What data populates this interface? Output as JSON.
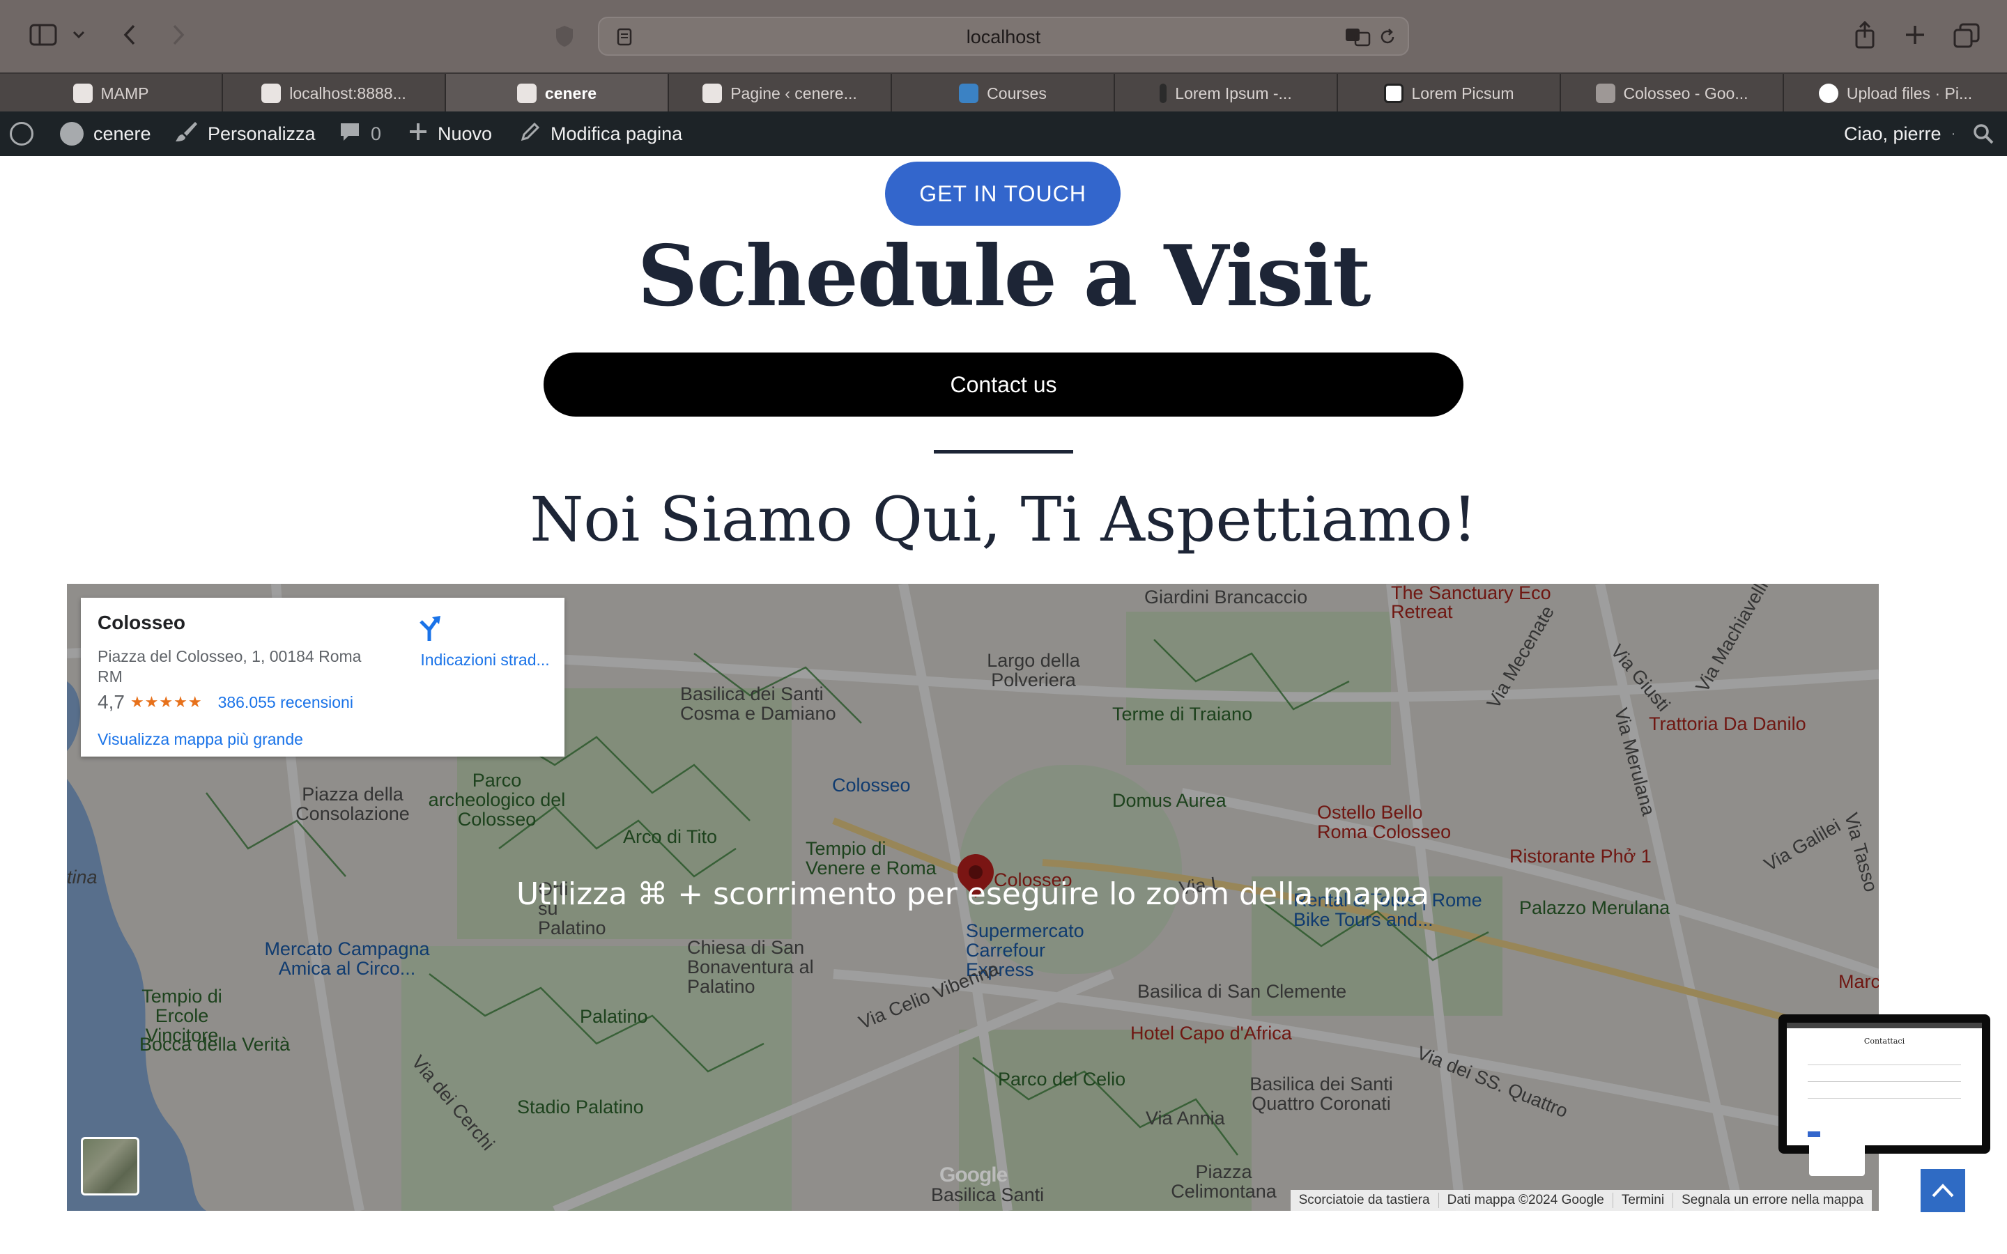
{
  "browser": {
    "url": "localhost",
    "tabs": [
      {
        "label": "MAMP",
        "active": false
      },
      {
        "label": "localhost:8888...",
        "active": false
      },
      {
        "label": "cenere",
        "active": true
      },
      {
        "label": "Pagine ‹ cenere...",
        "active": false
      },
      {
        "label": "Courses",
        "active": false
      },
      {
        "label": "Lorem Ipsum -...",
        "active": false
      },
      {
        "label": "Lorem Picsum",
        "active": false
      },
      {
        "label": "Colosseo - Goo...",
        "active": false
      },
      {
        "label": "Upload files · Pi...",
        "active": false
      }
    ]
  },
  "wpbar": {
    "site": "cenere",
    "customize": "Personalizza",
    "comments": "0",
    "new": "Nuovo",
    "edit": "Modifica pagina",
    "greeting": "Ciao, pierre"
  },
  "page": {
    "get_in_touch": "GET IN TOUCH",
    "title": "Schedule a Visit",
    "contact_button": "Contact us",
    "subtitle": "Noi Siamo Qui, Ti Aspettiamo!"
  },
  "map": {
    "zoom_message": "Utilizza ⌘ + scorrimento per eseguire lo zoom della mappa",
    "place_name": "Colosseo",
    "address": "Piazza del Colosseo, 1, 00184 Roma RM",
    "rating": "4,7",
    "stars": "★★★★★",
    "reviews": "386.055 recensioni",
    "directions": "Indicazioni strad...",
    "larger_map": "Visualizza mappa più grande",
    "attribution": {
      "shortcuts": "Scorciatoie da tastiera",
      "data": "Dati mappa ©2024 Google",
      "terms": "Termini",
      "report": "Segnala un errore nella mappa"
    },
    "google_logo": "Google",
    "labels": {
      "giardini": "Giardini Brancaccio",
      "sanctuary": "The Sanctuary Eco Retreat",
      "largo": "Largo della Polveriera",
      "basilica_cosma": "Basilica dei Santi Cosma e Damiano",
      "terme": "Terme di Traiano",
      "trattoria": "Trattoria Da Danilo",
      "piazza_consolazione": "Piazza della Consolazione",
      "parco_arch": "Parco archeologico del Colosseo",
      "colosseo_metro": "Colosseo",
      "domus": "Domus Aurea",
      "ostello": "Ostello Bello Roma Colosseo",
      "arco": "Arco di Tito",
      "tempio_venere": "Tempio di Venere e Roma",
      "ristorante": "Ristorante Phở 1",
      "colosseo_pin": "Colosseo",
      "rental": "Rental & Tours | Rome Bike Tours and...",
      "palazzo": "Palazzo Merulana",
      "mercato": "Mercato Campagna Amica al Circo...",
      "chiesa": "Chiesa di San Bonaventura al Palatino",
      "supermercato": "Supermercato Carrefour Express",
      "tempio_ercole": "Tempio di Ercole Vincitore",
      "bocca": "Bocca della Verità",
      "palatino": "Palatino",
      "celio": "Via Celio Vibenna",
      "basilica_clemente": "Basilica di San Clemente",
      "hotel": "Hotel Capo d'Africa",
      "parco_celio": "Parco del Celio",
      "basilica_quattro": "Basilica dei Santi Quattro Coronati",
      "stadio": "Stadio Palatino",
      "cerchi": "Via dei Cerchi",
      "annia": "Via Annia",
      "ss_quattro": "Via dei SS. Quattro",
      "celimontana": "Piazza Celimontana",
      "basilica_bottom": "Basilica Santi",
      "mecenate": "Via Mecenate",
      "giusti": "Via Giusti",
      "machiavelli": "Via Machiavelli",
      "merulana": "Via Merulana",
      "galilei": "Via Galilei",
      "tasso": "Via Tasso",
      "vinalia": "Via L",
      "tina": "tina",
      "orti": "Orti su Palatino",
      "marc": "Marc"
    }
  },
  "thumb_window": {
    "title": "Contattaci"
  },
  "scroll_top": "⌃"
}
